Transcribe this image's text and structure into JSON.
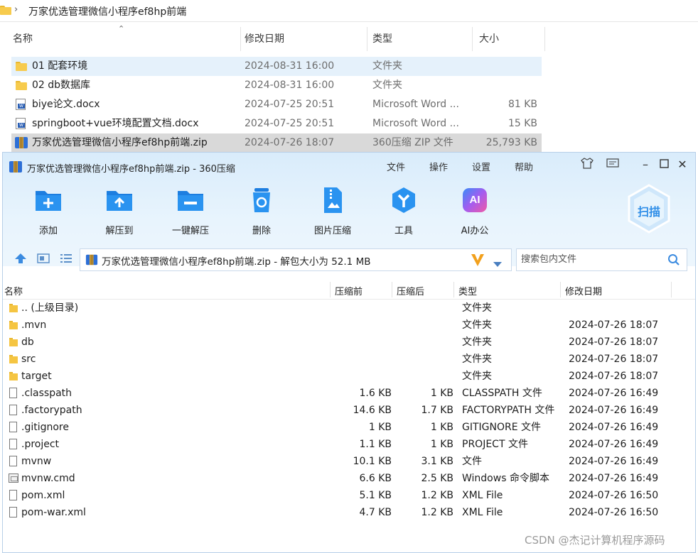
{
  "explorer": {
    "breadcrumb": "万家优选管理微信小程序ef8hp前端",
    "columns": [
      "名称",
      "修改日期",
      "类型",
      "大小"
    ],
    "rows": [
      {
        "name": "01 配套环境",
        "date": "2024-08-31 16:00",
        "type": "文件夹",
        "size": "",
        "icon": "folder-icon"
      },
      {
        "name": "02 db数据库",
        "date": "2024-08-31 16:00",
        "type": "文件夹",
        "size": "",
        "icon": "folder-icon"
      },
      {
        "name": "biye论文.docx",
        "date": "2024-07-25 20:51",
        "type": "Microsoft Word ...",
        "size": "81 KB",
        "icon": "word-doc-icon"
      },
      {
        "name": "springboot+vue环境配置文档.docx",
        "date": "2024-07-25 20:51",
        "type": "Microsoft Word ...",
        "size": "15 KB",
        "icon": "word-doc-icon"
      },
      {
        "name": "万家优选管理微信小程序ef8hp前端.zip",
        "date": "2024-07-26 18:07",
        "type": "360压缩 ZIP 文件",
        "size": "25,793 KB",
        "icon": "zip-archive-icon"
      }
    ]
  },
  "zip": {
    "title": "万家优选管理微信小程序ef8hp前端.zip - 360压缩",
    "menu": [
      "文件",
      "操作",
      "设置",
      "帮助"
    ],
    "toolbar": [
      "添加",
      "解压到",
      "一键解压",
      "删除",
      "图片压缩",
      "工具",
      "AI办公"
    ],
    "ai_badge": "AI",
    "scan_label": "扫描",
    "path_text": "万家优选管理微信小程序ef8hp前端.zip - 解包大小为 52.1 MB",
    "search_placeholder": "搜索包内文件",
    "list_columns": [
      "名称",
      "压缩前",
      "压缩后",
      "类型",
      "修改日期"
    ],
    "rows": [
      {
        "name": ".. (上级目录)",
        "before": "",
        "after": "",
        "type": "文件夹",
        "date": "",
        "icon": "folder-icon"
      },
      {
        "name": ".mvn",
        "before": "",
        "after": "",
        "type": "文件夹",
        "date": "2024-07-26 18:07",
        "icon": "folder-icon"
      },
      {
        "name": "db",
        "before": "",
        "after": "",
        "type": "文件夹",
        "date": "2024-07-26 18:07",
        "icon": "folder-icon"
      },
      {
        "name": "src",
        "before": "",
        "after": "",
        "type": "文件夹",
        "date": "2024-07-26 18:07",
        "icon": "folder-icon"
      },
      {
        "name": "target",
        "before": "",
        "after": "",
        "type": "文件夹",
        "date": "2024-07-26 18:07",
        "icon": "folder-icon"
      },
      {
        "name": ".classpath",
        "before": "1.6 KB",
        "after": "1 KB",
        "type": "CLASSPATH 文件",
        "date": "2024-07-26 16:49",
        "icon": "file-icon"
      },
      {
        "name": ".factorypath",
        "before": "14.6 KB",
        "after": "1.7 KB",
        "type": "FACTORYPATH 文件",
        "date": "2024-07-26 16:49",
        "icon": "file-icon"
      },
      {
        "name": ".gitignore",
        "before": "1 KB",
        "after": "1 KB",
        "type": "GITIGNORE 文件",
        "date": "2024-07-26 16:49",
        "icon": "file-icon"
      },
      {
        "name": ".project",
        "before": "1.1 KB",
        "after": "1 KB",
        "type": "PROJECT 文件",
        "date": "2024-07-26 16:49",
        "icon": "file-icon"
      },
      {
        "name": "mvnw",
        "before": "10.1 KB",
        "after": "3.1 KB",
        "type": "文件",
        "date": "2024-07-26 16:49",
        "icon": "file-icon"
      },
      {
        "name": "mvnw.cmd",
        "before": "6.6 KB",
        "after": "2.5 KB",
        "type": "Windows 命令脚本",
        "date": "2024-07-26 16:49",
        "icon": "cmd-script-icon"
      },
      {
        "name": "pom.xml",
        "before": "5.1 KB",
        "after": "1.2 KB",
        "type": "XML File",
        "date": "2024-07-26 16:50",
        "icon": "file-icon"
      },
      {
        "name": "pom-war.xml",
        "before": "4.7 KB",
        "after": "1.2 KB",
        "type": "XML File",
        "date": "2024-07-26 16:50",
        "icon": "file-icon"
      }
    ]
  },
  "watermark": "CSDN @杰记计算机程序源码",
  "colors": {
    "accent": "#2b8be6",
    "selection": "#e5f1fb",
    "highlight_row": "#d9d9d9",
    "topbar": "#d9ecfb",
    "folder": "#f7cb4d"
  }
}
